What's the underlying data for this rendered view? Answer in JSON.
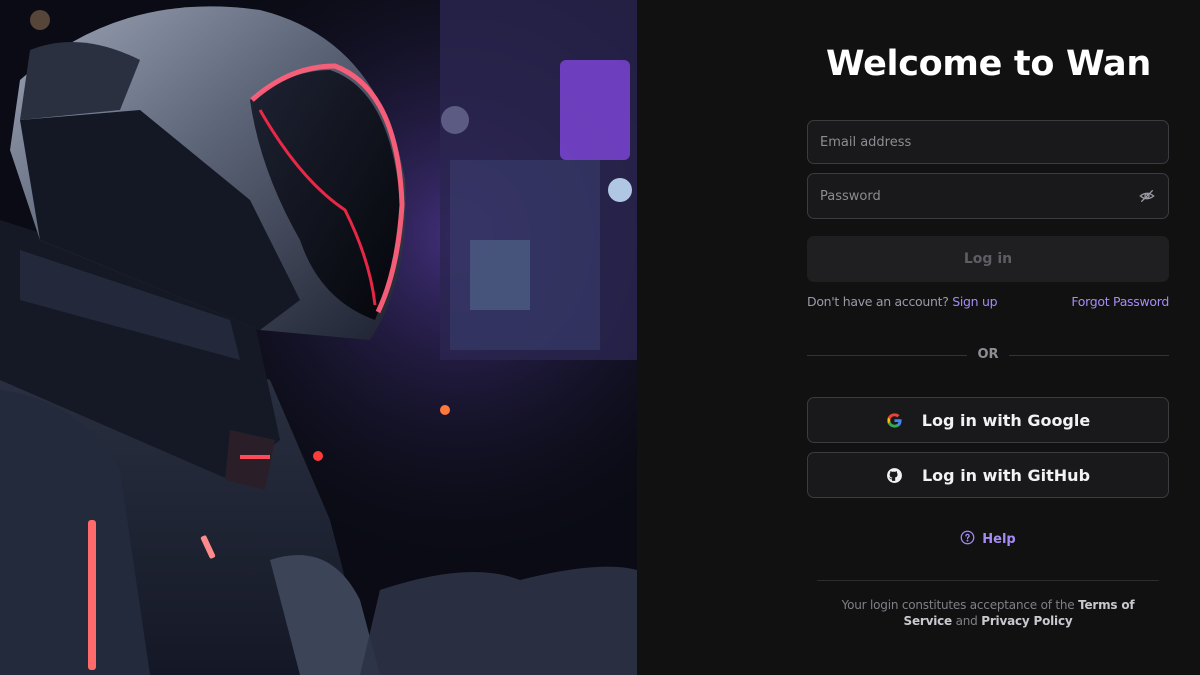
{
  "hero": {
    "image": "astronaut-helmet-neon-illustration"
  },
  "login": {
    "title": "Welcome to Wan",
    "email_placeholder": "Email address",
    "password_placeholder": "Password",
    "login_button": "Log in",
    "no_account_text": "Don't have an account?",
    "sign_up_link": "Sign up",
    "forgot_password_link": "Forgot Password",
    "divider_text": "OR",
    "google_button": "Log in with Google",
    "github_button": "Log in with GitHub",
    "help_link": "Help",
    "terms_prefix": "Your login constitutes acceptance of the",
    "terms_link": "Terms of Service",
    "terms_and": "and",
    "privacy_link": "Privacy Policy"
  },
  "icons": {
    "password_toggle": "eye-off-icon",
    "google": "google-icon",
    "github": "github-icon",
    "help": "question-circle-icon"
  },
  "colors": {
    "background": "#111112",
    "accent": "#a58bf5",
    "field_border": "#3b3b40",
    "field_bg": "#19191c",
    "disabled_button_bg": "#1f1f22"
  }
}
